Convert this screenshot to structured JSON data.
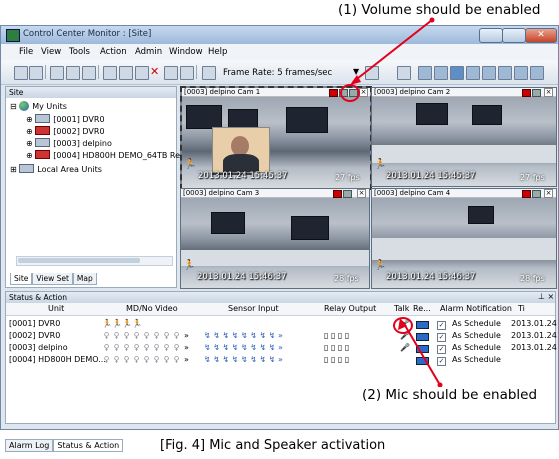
{
  "annotations": {
    "callout_top": "(1) Volume should be enabled",
    "callout_bottom": "(2) Mic should be enabled",
    "figure_caption": "[Fig. 4] Mic and Speaker activation"
  },
  "window": {
    "title": "Control Center Monitor : [Site]",
    "menu": [
      "File",
      "View",
      "Tools",
      "Action",
      "Admin",
      "Window",
      "Help"
    ],
    "frame_rate_label": "Frame Rate: 5 frames/sec"
  },
  "site_panel": {
    "title": "Site",
    "root": "My Units",
    "units": [
      "[0001] DVR0",
      "[0002] DVR0",
      "[0003] delpino",
      "[0004] HD800H DEMO_64TB Rec"
    ],
    "local": "Local Area Units",
    "tabs": [
      "Site",
      "View Set",
      "Map"
    ]
  },
  "cameras": [
    {
      "title": "[0003] delpino Cam 1",
      "timestamp": "2013.01.24 15:45:37",
      "fps": "27 fps"
    },
    {
      "title": "[0003] delpino Cam 2",
      "timestamp": "2013.01.24 15:45:37",
      "fps": "27 fps"
    },
    {
      "title": "[0003] delpino Cam 3",
      "timestamp": "2013.01.24 15:46:37",
      "fps": "28 fps"
    },
    {
      "title": "[0003] delpino Cam 4",
      "timestamp": "2013.01.24 15:46:37",
      "fps": "28 fps"
    }
  ],
  "status_panel": {
    "title": "Status & Action",
    "columns": {
      "unit": "Unit",
      "mdno": "MD/No Video",
      "sensor": "Sensor Input",
      "relay": "Relay Output",
      "talk": "Talk",
      "re": "Re...",
      "alarm": "Alarm Notification",
      "ti": "Ti"
    },
    "rows": [
      {
        "unit": "[0001] DVR0",
        "alarm": "As Schedule",
        "time": "2013.01.24"
      },
      {
        "unit": "[0002] DVR0",
        "alarm": "As Schedule",
        "time": "2013.01.24"
      },
      {
        "unit": "[0003] delpino",
        "alarm": "As Schedule",
        "time": "2013.01.24"
      },
      {
        "unit": "[0004] HD800H DEMO...",
        "alarm": "As Schedule",
        "time": ""
      }
    ],
    "bottom_tabs": [
      "Alarm Log",
      "Status & Action"
    ]
  },
  "colors": {
    "callout_arrow": "#e3001b",
    "title_gradient": "#9db9da"
  }
}
